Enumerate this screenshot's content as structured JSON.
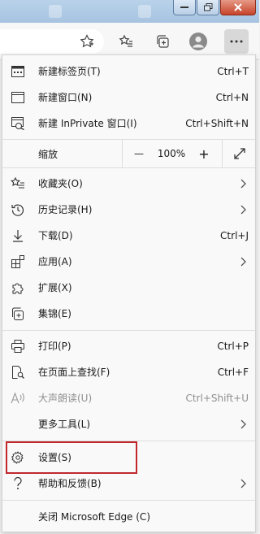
{
  "menu": {
    "new_tab": {
      "label": "新建标签页(T)",
      "shortcut": "Ctrl+T"
    },
    "new_window": {
      "label": "新建窗口(N)",
      "shortcut": "Ctrl+N"
    },
    "new_inprivate": {
      "label": "新建 InPrivate 窗口(I)",
      "shortcut": "Ctrl+Shift+N"
    },
    "zoom": {
      "label": "缩放",
      "minus": "—",
      "value": "100%",
      "plus": "+"
    },
    "favorites": {
      "label": "收藏夹(O)"
    },
    "history": {
      "label": "历史记录(H)"
    },
    "downloads": {
      "label": "下载(D)",
      "shortcut": "Ctrl+J"
    },
    "apps": {
      "label": "应用(A)"
    },
    "extensions": {
      "label": "扩展(X)"
    },
    "collections": {
      "label": "集锦(E)"
    },
    "print": {
      "label": "打印(P)",
      "shortcut": "Ctrl+P"
    },
    "find": {
      "label": "在页面上查找(F)",
      "shortcut": "Ctrl+F"
    },
    "read_aloud": {
      "label": "大声朗读(U)",
      "shortcut": "Ctrl+Shift+U"
    },
    "more_tools": {
      "label": "更多工具(L)"
    },
    "settings": {
      "label": "设置(S)"
    },
    "help": {
      "label": "帮助和反馈(B)"
    },
    "close": {
      "label": "关闭 Microsoft Edge (C)"
    }
  },
  "toolbar": {
    "icons": [
      "favorite-star-icon",
      "favorites-list-icon",
      "collections-icon",
      "profile-avatar-icon",
      "more-menu-icon"
    ]
  },
  "colors": {
    "highlight": "#c0272d",
    "menu_bg": "#f9f9f9",
    "titlebar": "#a6c3e0"
  }
}
